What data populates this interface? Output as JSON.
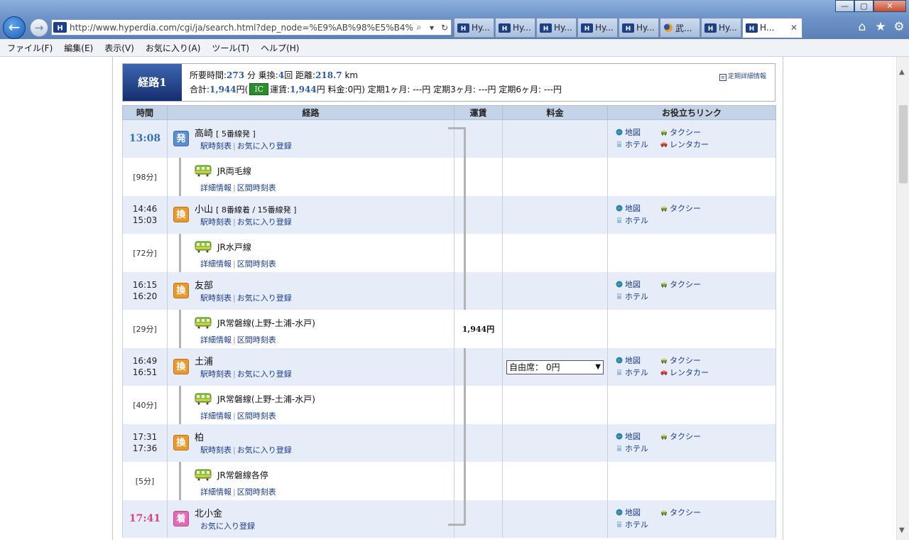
{
  "browser": {
    "address_url": "http://www.hyperdia.com/cgi/ja/search.html?dep_node=%E9%AB%98%E5%B4%8",
    "tabs": [
      {
        "label": "Hy..."
      },
      {
        "label": "Hy..."
      },
      {
        "label": "Hy..."
      },
      {
        "label": "Hy..."
      },
      {
        "label": "Hy..."
      },
      {
        "label": "武..."
      },
      {
        "label": "Hy..."
      },
      {
        "label": "H..."
      }
    ],
    "menu": [
      "ファイル(F)",
      "編集(E)",
      "表示(V)",
      "お気に入り(A)",
      "ツール(T)",
      "ヘルプ(H)"
    ]
  },
  "summary": {
    "route_label": "経路1",
    "time_label": "所要時間:",
    "time_value": "273",
    "time_unit": "分",
    "transfers_label": "乗換:",
    "transfers_value": "4",
    "transfers_unit": "回",
    "distance_label": "距離:",
    "distance_value": "218.7",
    "distance_unit": "km",
    "total_label": "合計:",
    "total_value": "1,944",
    "total_unit": "円(",
    "ic_label": "IC",
    "fare_label": "運賃:",
    "fare_value": "1,944",
    "fare_unit": "円",
    "charge_label": "料金:",
    "charge_value": "0",
    "charge_unit": "円)",
    "teiki1": "定期1ヶ月: ---円",
    "teiki3": "定期3ヶ月: ---円",
    "teiki6": "定期6ヶ月: ---円",
    "teiki_link": "定期詳細情報"
  },
  "table": {
    "headers": {
      "time": "時間",
      "route": "経路",
      "fare": "運賃",
      "charge": "料金",
      "links": "お役立ちリンク"
    },
    "rows": [
      {
        "kind": "station",
        "t1": "13:08",
        "t2": "",
        "badge": "発",
        "name": "高崎",
        "sub": "[ 5番線発 ]",
        "links": [
          "駅時刻表",
          "お気に入り登録"
        ],
        "useful": [
          "地図",
          "タクシー",
          "ホテル",
          "レンタカー"
        ]
      },
      {
        "kind": "segment",
        "duration": "[98分]",
        "line": "JR両毛線",
        "links": [
          "詳細情報",
          "区間時刻表"
        ]
      },
      {
        "kind": "station",
        "t1": "14:46",
        "t2": "15:03",
        "badge": "換",
        "name": "小山",
        "sub": "[ 8番線着 / 15番線発 ]",
        "links": [
          "駅時刻表",
          "お気に入り登録"
        ],
        "useful": [
          "地図",
          "タクシー",
          "ホテル"
        ]
      },
      {
        "kind": "segment",
        "duration": "[72分]",
        "line": "JR水戸線",
        "links": [
          "詳細情報",
          "区間時刻表"
        ]
      },
      {
        "kind": "station",
        "t1": "16:15",
        "t2": "16:20",
        "badge": "換",
        "name": "友部",
        "sub": "",
        "links": [
          "駅時刻表",
          "お気に入り登録"
        ],
        "useful": [
          "地図",
          "タクシー",
          "ホテル"
        ]
      },
      {
        "kind": "segment",
        "duration": "[29分]",
        "line": "JR常磐線(上野-土浦-水戸)",
        "links": [
          "詳細情報",
          "区間時刻表"
        ],
        "fare": "1,944円"
      },
      {
        "kind": "station",
        "t1": "16:49",
        "t2": "16:51",
        "badge": "換",
        "name": "土浦",
        "sub": "",
        "links": [
          "駅時刻表",
          "お気に入り登録"
        ],
        "useful": [
          "地図",
          "タクシー",
          "ホテル",
          "レンタカー"
        ],
        "select": "自由席： 0円"
      },
      {
        "kind": "segment",
        "duration": "[40分]",
        "line": "JR常磐線(上野-土浦-水戸)",
        "links": [
          "詳細情報",
          "区間時刻表"
        ]
      },
      {
        "kind": "station",
        "t1": "17:31",
        "t2": "17:36",
        "badge": "換",
        "name": "柏",
        "sub": "",
        "links": [
          "駅時刻表",
          "お気に入り登録"
        ],
        "useful": [
          "地図",
          "タクシー",
          "ホテル"
        ]
      },
      {
        "kind": "segment",
        "duration": "[5分]",
        "line": "JR常磐線各停",
        "links": [
          "詳細情報",
          "区間時刻表"
        ]
      },
      {
        "kind": "station",
        "t1": "17:41",
        "t2": "",
        "badge": "着",
        "name": "北小金",
        "sub": "",
        "links": [
          "お気に入り登録"
        ],
        "useful": [
          "地図",
          "タクシー",
          "ホテル"
        ]
      }
    ]
  },
  "colors": {
    "accent": "#3270b8",
    "arrival": "#d5477f",
    "header_bg": "#c5d3e8",
    "row_bg": "#e6edf8"
  }
}
